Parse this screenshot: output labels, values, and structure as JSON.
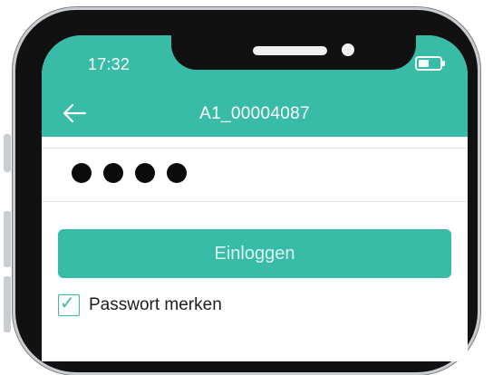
{
  "status_bar": {
    "time": "17:32",
    "icons": [
      "signal-icon",
      "wifi-icon",
      "battery-icon"
    ]
  },
  "nav": {
    "back_icon": "arrow-left-icon",
    "title": "A1_00004087"
  },
  "form": {
    "password_masked": "••••",
    "password_length": 4,
    "login_button_label": "Einloggen",
    "remember": {
      "checked": true,
      "label": "Passwort merken"
    }
  },
  "colors": {
    "accent": "#38bca8",
    "button_text": "#d8f5f0",
    "text_primary": "#1d1d1d",
    "mask_dots": "#0b0b0b"
  }
}
